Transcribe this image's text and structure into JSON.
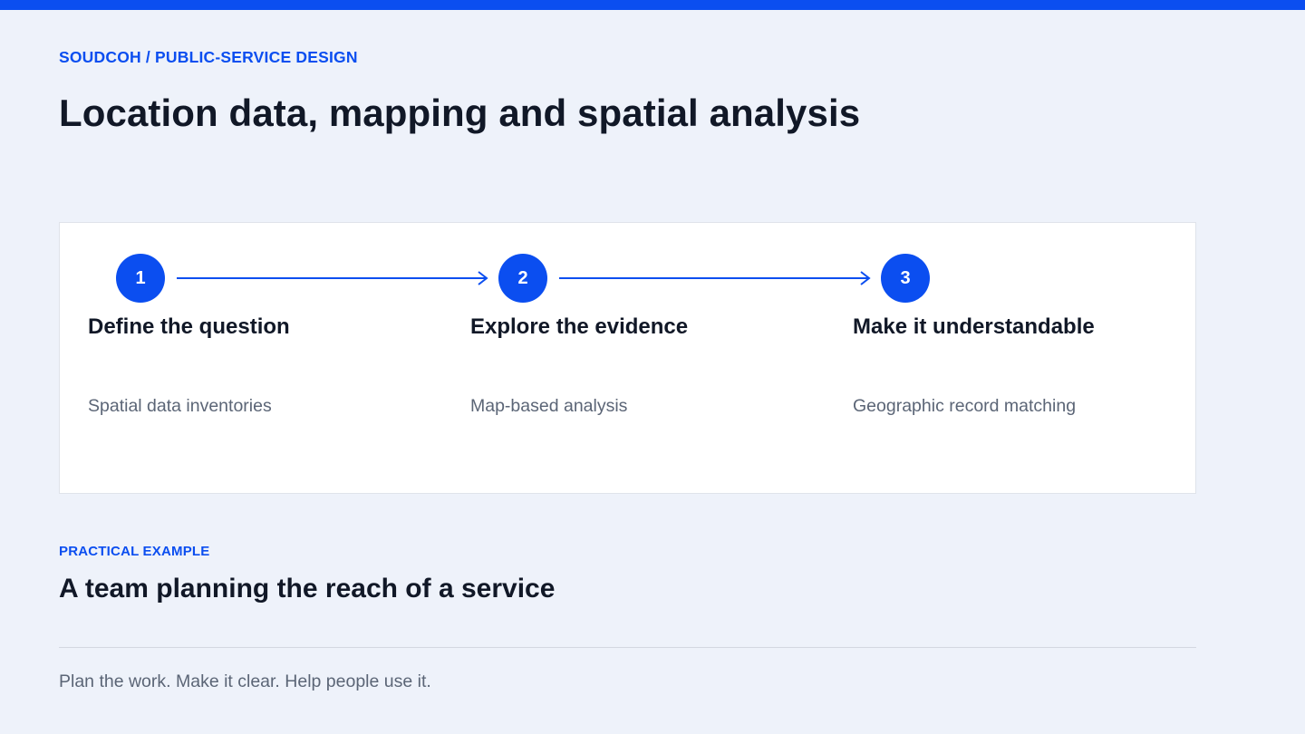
{
  "header": {
    "eyebrow": "SOUDCOH / PUBLIC-SERVICE DESIGN",
    "title": "Location data, mapping and spatial analysis"
  },
  "steps": [
    {
      "number": "1",
      "title": "Define the question",
      "description": "Spatial data inventories"
    },
    {
      "number": "2",
      "title": "Explore the evidence",
      "description": "Map-based analysis"
    },
    {
      "number": "3",
      "title": "Make it understandable",
      "description": "Geographic record matching"
    }
  ],
  "example": {
    "eyebrow": "PRACTICAL EXAMPLE",
    "title": "A team planning the reach of a service"
  },
  "footer": {
    "text": "Plan the work. Make it clear. Help people use it."
  },
  "colors": {
    "accent": "#0b4ef0",
    "background": "#eef2fa",
    "card": "#ffffff",
    "muted_text": "#5b6576"
  },
  "icons": {
    "step_connector": "arrow-right-icon"
  }
}
